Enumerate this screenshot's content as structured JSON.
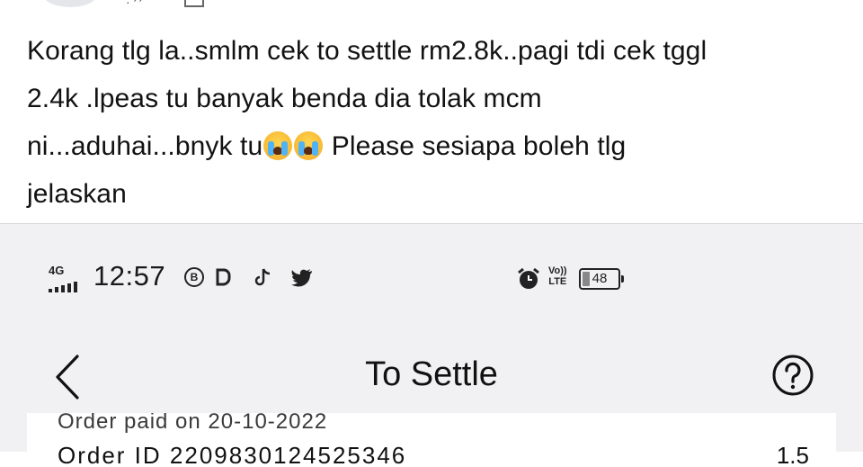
{
  "post": {
    "text_line1": "Korang tlg la..smlm cek to settle rm2.8k..pagi tdi cek tggl",
    "text_line2": "2.4k .lpeas tu banyak benda dia tolak mcm",
    "text_line3_a": "ni...aduhai...bnyk tu",
    "text_line3_b": " Please sesiapa boleh tlg",
    "text_line4": "jelaskan",
    "emojis": [
      "loudly-crying-face-emoji",
      "loudly-crying-face-emoji"
    ]
  },
  "screenshot": {
    "status_bar": {
      "network": "4G",
      "time": "12:57",
      "bixby_letter": "B",
      "icons": [
        "signal-icon",
        "bixby-icon",
        "b-app-icon",
        "tiktok-icon",
        "twitter-icon",
        "alarm-icon",
        "volte-icon",
        "battery-icon"
      ],
      "volte_top": "Vo))",
      "volte_bottom": "LTE",
      "battery": "48"
    },
    "nav": {
      "title": "To Settle",
      "back_icon": "chevron-left-icon",
      "help_icon": "help-circle-icon"
    },
    "card": {
      "order_paid_partial": "Order paid on 20-10-2022",
      "order_id_partial": "Order ID 2209830124525346",
      "amount_partial": "1.5"
    },
    "colors": {
      "page_bg": "#ffffff",
      "screenshot_bg": "#f1f1f3",
      "text": "#111111"
    }
  }
}
